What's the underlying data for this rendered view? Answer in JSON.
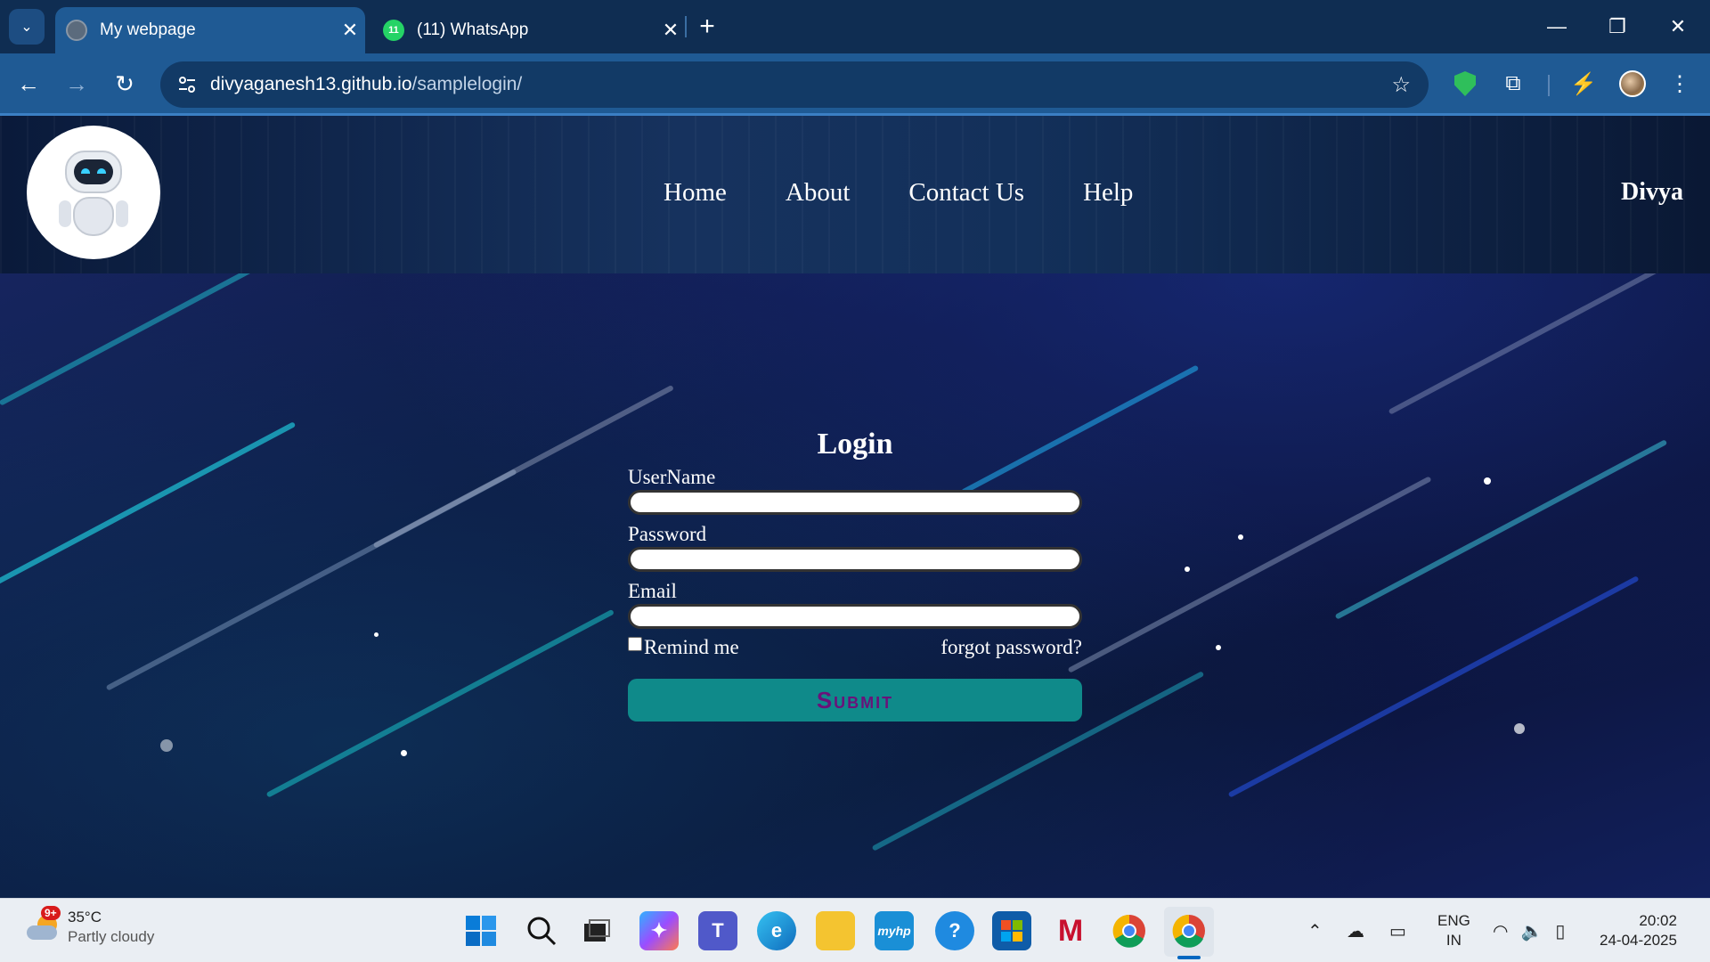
{
  "browser": {
    "tabs": [
      {
        "title": "My webpage",
        "active": true
      },
      {
        "title": "(11) WhatsApp",
        "active": false,
        "badge": "11"
      }
    ],
    "new_tab_symbol": "+",
    "url_domain": "divyaganesh13.github.io",
    "url_path": "/samplelogin/",
    "window_controls": {
      "minimize": "—",
      "restore": "❐",
      "close": "✕"
    }
  },
  "site": {
    "nav": [
      "Home",
      "About",
      "Contact Us",
      "Help"
    ],
    "user": "Divya"
  },
  "login": {
    "heading": "Login",
    "username_label": "UserName",
    "password_label": "Password",
    "email_label": "Email",
    "remember_label": "Remind me",
    "forgot_link": "forgot password?",
    "submit_label": "Submit"
  },
  "taskbar": {
    "weather": {
      "temp": "35°C",
      "condition": "Partly cloudy",
      "badge": "9+"
    },
    "language": {
      "line1": "ENG",
      "line2": "IN"
    },
    "clock": {
      "time": "20:02",
      "date": "24-04-2025"
    }
  },
  "colors": {
    "tab_strip": "#0f2d52",
    "toolbar": "#1f5a94",
    "submit_bg": "#0f8a8a",
    "submit_text": "#6a127a"
  }
}
